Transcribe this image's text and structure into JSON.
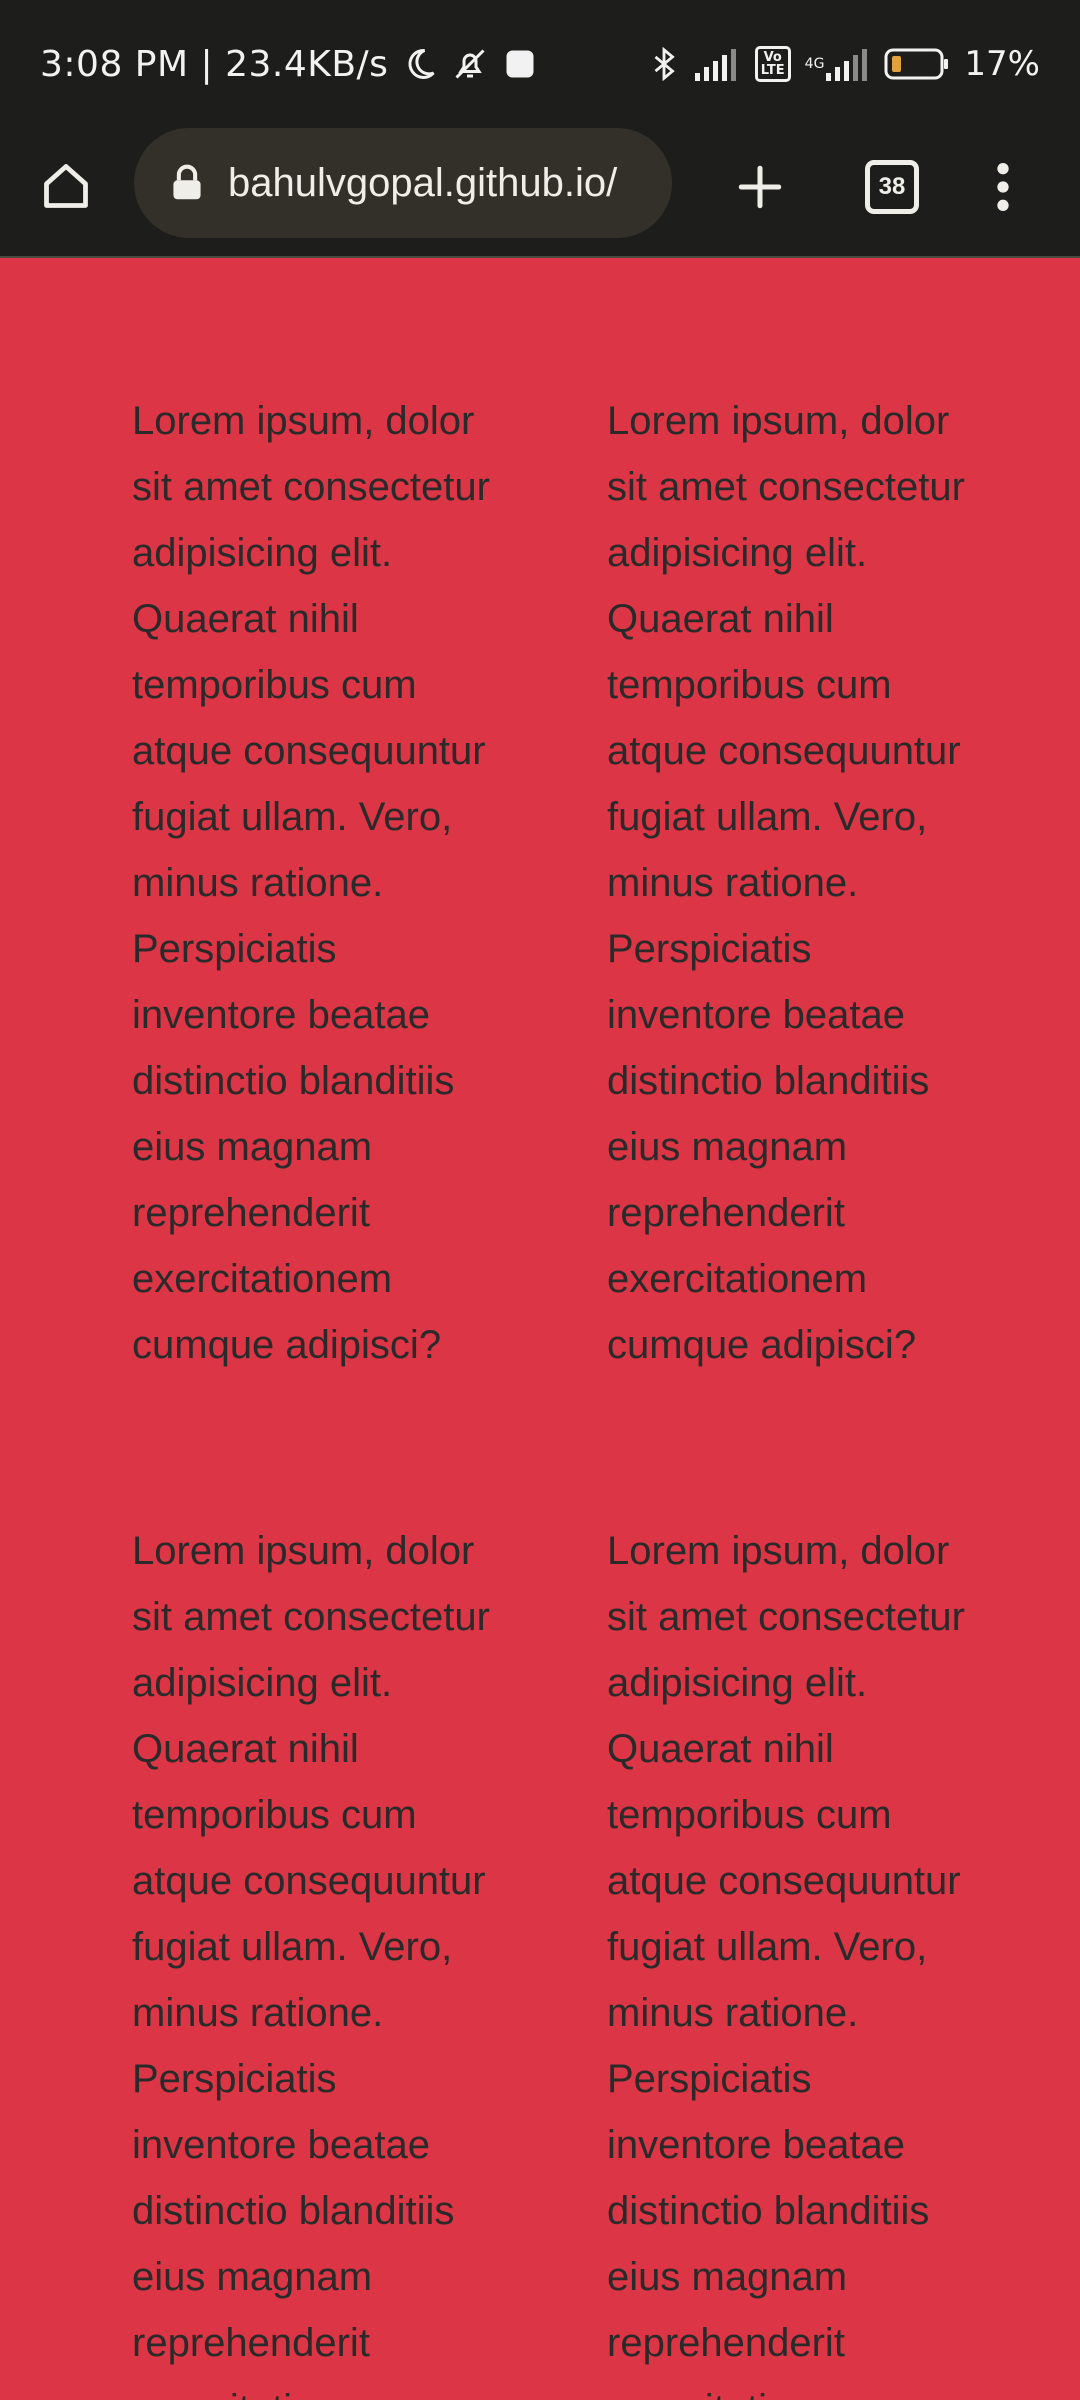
{
  "status_bar": {
    "time_and_speed": "3:08 PM | 23.4KB/s",
    "volte_label": "Vo\nLTE",
    "network_type": "4G",
    "battery_percent": "17%",
    "icons": [
      "moon-icon",
      "bell-off-icon",
      "app-notification-icon",
      "bluetooth-icon",
      "signal-icon",
      "volte-icon",
      "signal-4g-icon",
      "battery-icon"
    ]
  },
  "browser": {
    "url": "bahulvgopal.github.io/",
    "tab_count": "38",
    "icons": [
      "home-icon",
      "lock-icon",
      "plus-icon",
      "tabs-icon",
      "more-vert-icon"
    ]
  },
  "content": {
    "paragraphs": [
      "Lorem ipsum, dolor sit amet consectetur adipisicing elit. Quaerat nihil temporibus cum atque consequuntur fugiat ullam. Vero, minus ratione. Perspiciatis inventore beatae distinctio blanditiis eius magnam reprehenderit exercitationem cumque adipisci?",
      "Lorem ipsum, dolor sit amet consectetur adipisicing elit. Quaerat nihil temporibus cum atque consequuntur fugiat ullam. Vero, minus ratione. Perspiciatis inventore beatae distinctio blanditiis eius magnam reprehenderit exercitationem cumque adipisci?",
      "Lorem ipsum, dolor sit amet consectetur adipisicing elit. Quaerat nihil temporibus cum atque consequuntur fugiat ullam. Vero, minus ratione. Perspiciatis inventore beatae distinctio blanditiis eius magnam reprehenderit exercitationem cumque adipisci?",
      "Lorem ipsum, dolor sit amet consectetur adipisicing elit. Quaerat nihil temporibus cum atque consequuntur fugiat ullam. Vero, minus ratione. Perspiciatis inventore beatae distinctio blanditiis eius magnam reprehenderit exercitationem cumque adipisci?"
    ]
  },
  "colors": {
    "page_background": "#dc3545",
    "browser_chrome": "#1d1d1b",
    "url_pill": "#33302a",
    "text": "#2a2a2a"
  }
}
